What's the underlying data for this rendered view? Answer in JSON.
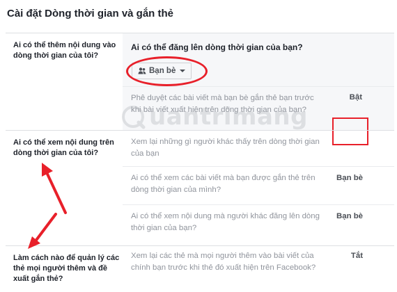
{
  "page": {
    "title": "Cài đặt Dòng thời gian và gắn thẻ"
  },
  "sections": [
    {
      "category": "Ai có thể thêm nội dung vào dòng thời gian của tôi?",
      "header": "Ai có thể đăng lên dòng thời gian của bạn?",
      "audience_button": "Bạn bè",
      "items": [
        {
          "text": "Phê duyệt các bài viết mà bạn bè gắn thẻ bạn trước khi bài viết xuất hiện trên dòng thời gian của bạn?",
          "value": "Bật"
        }
      ]
    },
    {
      "category": "Ai có thể xem nội dung trên dòng thời gian của tôi?",
      "items": [
        {
          "text": "Xem lại những gì người khác thấy trên dòng thời gian của bạn",
          "value": ""
        },
        {
          "text": "Ai có thể xem các bài viết mà bạn được gắn thẻ trên dòng thời gian của mình?",
          "value": "Bạn bè"
        },
        {
          "text": "Ai có thể xem nội dung mà người khác đăng lên dòng thời gian của bạn?",
          "value": "Bạn bè"
        }
      ]
    },
    {
      "category": "Làm cách nào để quản lý các thẻ mọi người thêm và đề xuất gắn thẻ?",
      "items": [
        {
          "text": "Xem lại các thẻ mà mọi người thêm vào bài viết của chính bạn trước khi thẻ đó xuất hiện trên Facebook?",
          "value": "Tắt"
        }
      ]
    }
  ],
  "watermark": {
    "text": "uantrimang"
  },
  "annotations": {
    "highlight_color": "#e8202a"
  }
}
